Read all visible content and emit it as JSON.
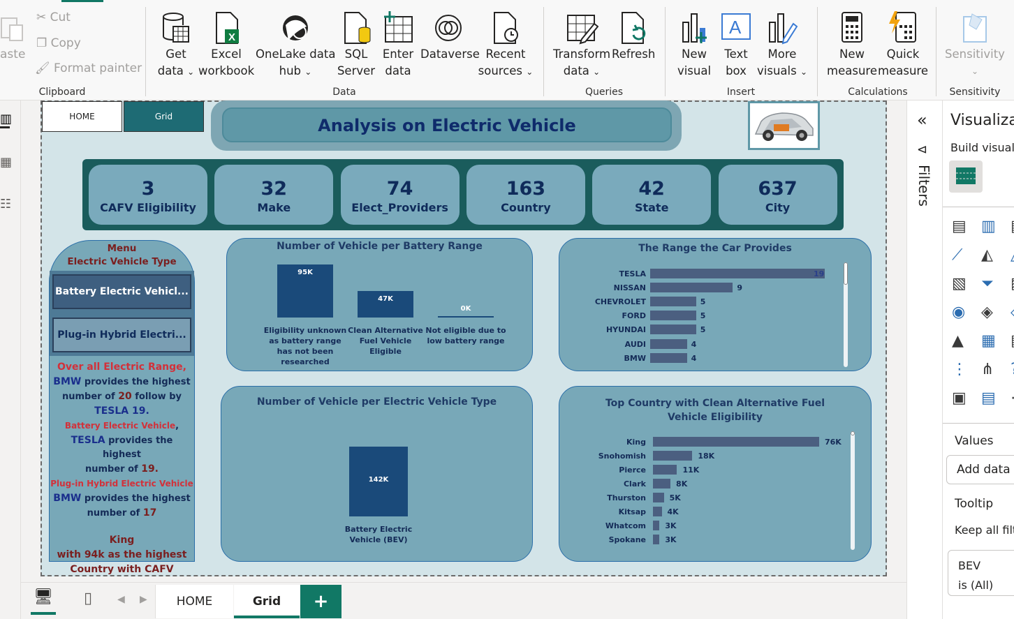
{
  "ribbon": {
    "clipboard": {
      "paste": "aste",
      "cut": "Cut",
      "copy": "Copy",
      "format_painter": "Format painter",
      "group": "Clipboard"
    },
    "data": {
      "get_data": [
        "Get",
        "data"
      ],
      "excel": [
        "Excel",
        "workbook"
      ],
      "onelake": [
        "OneLake data",
        "hub"
      ],
      "sql": [
        "SQL",
        "Server"
      ],
      "enter": [
        "Enter",
        "data"
      ],
      "dataverse": "Dataverse",
      "recent": [
        "Recent",
        "sources"
      ],
      "group": "Data"
    },
    "queries": {
      "transform": [
        "Transform",
        "data"
      ],
      "refresh": "Refresh",
      "group": "Queries"
    },
    "insert": {
      "new_visual": [
        "New",
        "visual"
      ],
      "text_box": [
        "Text",
        "box"
      ],
      "more_visuals": [
        "More",
        "visuals"
      ],
      "group": "Insert"
    },
    "calculations": {
      "new_measure": [
        "New",
        "measure"
      ],
      "quick_measure": [
        "Quick",
        "measure"
      ],
      "group": "Calculations"
    },
    "sensitivity": {
      "label": "Sensitivity",
      "group": "Sensitivity"
    }
  },
  "report": {
    "nav": {
      "home": "HOME",
      "grid": "Grid"
    },
    "title": "Analysis on Electric Vehicle",
    "kpis": [
      {
        "value": "3",
        "label": "CAFV Eligibility"
      },
      {
        "value": "32",
        "label": "Make"
      },
      {
        "value": "74",
        "label": "Elect_Providers"
      },
      {
        "value": "163",
        "label": "Country"
      },
      {
        "value": "42",
        "label": "State"
      },
      {
        "value": "637",
        "label": "City"
      }
    ],
    "menu": {
      "title": "Menu",
      "subtitle": "Electric Vehicle Type",
      "btn1": "Battery Electric Vehicl...",
      "btn2": "Plug-in Hybrid Electri...",
      "n1a": "Over all Electric Range,",
      "n1b": "BMW",
      "n1c": "provides the highest",
      "n1d": "number of",
      "n1e": "20",
      "n1f": "follow by",
      "n1g": "TESLA 19.",
      "n2a": "Battery Electric Vehicle",
      "n2b": "TESLA",
      "n2c": "provides the highest",
      "n2d": "number of",
      "n2e": "19.",
      "n3a": "Plug-in Hybrid Electric Vehicle",
      "n3b": "BMW",
      "n3c": "provides the highest",
      "n3d": "number of",
      "n3e": "17",
      "n4a": "King",
      "n4b": "with 94k as the highest",
      "n4c": "Country with CAFV"
    }
  },
  "chart_data": [
    {
      "type": "bar",
      "title": "Number of Vehicle per Battery Range",
      "categories": [
        "Eligibility unknown as battery range has not been researched",
        "Clean Alternative Fuel Vehicle Eligible",
        "Not eligible due to low battery range"
      ],
      "values": [
        95,
        47,
        0
      ],
      "labels": [
        "95K",
        "47K",
        "0K"
      ]
    },
    {
      "type": "bar",
      "orientation": "horizontal",
      "title": "The Range the Car Provides",
      "categories": [
        "TESLA",
        "NISSAN",
        "CHEVROLET",
        "FORD",
        "HYUNDAI",
        "AUDI",
        "BMW"
      ],
      "values": [
        19,
        9,
        5,
        5,
        5,
        4,
        4
      ]
    },
    {
      "type": "bar",
      "title": "Number of Vehicle per Electric Vehicle Type",
      "categories": [
        "Battery Electric Vehicle (BEV)"
      ],
      "values": [
        142
      ],
      "labels": [
        "142K"
      ]
    },
    {
      "type": "bar",
      "orientation": "horizontal",
      "title": "Top Country with Clean Alternative Fuel Vehicle Eligibility",
      "categories": [
        "King",
        "Snohomish",
        "Pierce",
        "Clark",
        "Thurston",
        "Kitsap",
        "Whatcom",
        "Spokane"
      ],
      "values": [
        76,
        18,
        11,
        8,
        5,
        4,
        3,
        3
      ],
      "labels": [
        "76K",
        "18K",
        "11K",
        "8K",
        "5K",
        "4K",
        "3K",
        "3K"
      ]
    }
  ],
  "panes": {
    "filters": "Filters",
    "viz_title": "Visualiza",
    "build": "Build visual",
    "values": "Values",
    "add_data": "Add data f",
    "tooltip": "Tooltip",
    "keep_filters": "Keep all filt",
    "filter_field": "BEV",
    "filter_value": "is (All)"
  },
  "pages": {
    "home": "HOME",
    "grid": "Grid",
    "add": "+"
  },
  "colors": {
    "teal_dark": "#1a5c5c",
    "card": "#7aaabc",
    "bar_dark": "#1a4a7a",
    "hbar": "#4b5f80",
    "accent_green": "#117865",
    "note_red": "#d2313a",
    "note_blue": "#1a2f8c"
  }
}
